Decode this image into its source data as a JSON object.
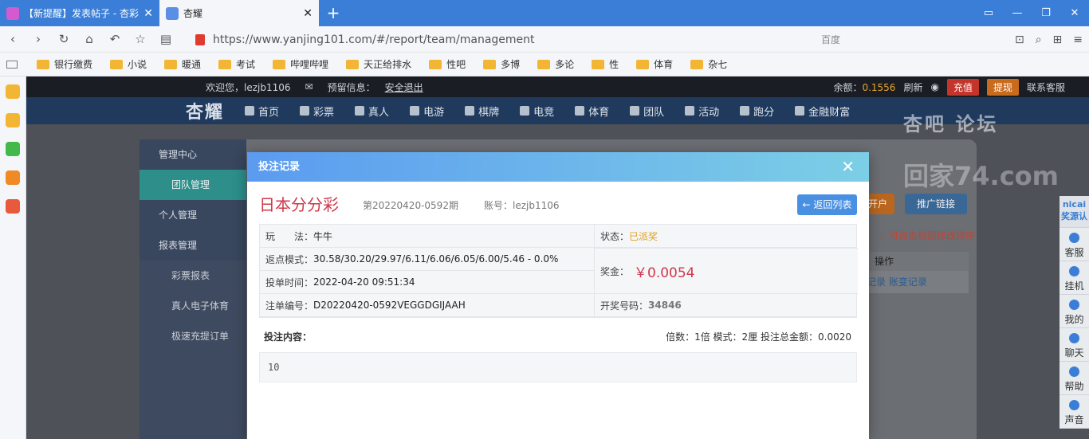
{
  "browser": {
    "tabs": [
      {
        "title": "【新提醒】发表帖子 - 杏彩"
      },
      {
        "title": "杏耀"
      }
    ],
    "url": "https://www.yanjing101.com/#/report/team/management",
    "search_placeholder": "百度"
  },
  "bookmarks": [
    "银行缴费",
    "小说",
    "暖通",
    "考试",
    "哔哩哔哩",
    "天正给排水",
    "性吧",
    "多博",
    "多论",
    "性",
    "体育",
    "杂七"
  ],
  "site": {
    "welcome": "欢迎您，lezjb1106",
    "reserve": "预留信息：",
    "logout": "安全退出",
    "balance_label": "余额：",
    "balance": "0.1556",
    "refresh": "刷新",
    "charge": "充值",
    "withdraw": "提现",
    "service": "联系客服",
    "logo": "杏耀",
    "nav": [
      "首页",
      "彩票",
      "真人",
      "电游",
      "棋牌",
      "电竞",
      "体育",
      "团队",
      "活动",
      "跑分",
      "金融财富"
    ]
  },
  "menu": {
    "groups": [
      {
        "label": "管理中心",
        "items": [
          "团队管理"
        ]
      },
      {
        "label": "个人管理",
        "items": []
      },
      {
        "label": "报表管理",
        "items": [
          "彩票报表",
          "真人电子体育",
          "极速充提订单"
        ]
      }
    ]
  },
  "bg": {
    "open_account": "开户",
    "promo_link": "推广链接",
    "hint": "：可点击标题修改排序",
    "op_header": "操作",
    "op_row": "记录  账变记录"
  },
  "rfloat": [
    "客服",
    "挂机",
    "我的",
    "聊天",
    "帮助",
    "声音"
  ],
  "rfloat_top": "nicai 奖源认",
  "watermark": {
    "line1": "杏吧 论坛",
    "line2": "回家74.com"
  },
  "modal": {
    "header": "投注记录",
    "game": "日本分分彩",
    "period": "第20220420-0592期",
    "account": "账号：lezjb1106",
    "back": "返回列表",
    "play_label": "玩　　法：",
    "play": "牛牛",
    "status_label": "状态：",
    "status": "已派奖",
    "rebate_label": "返点模式：",
    "rebate": "30.58/30.20/29.97/6.11/6.06/6.05/6.00/5.46 - 0.0%",
    "prize_label": "奖金：",
    "prize": "￥0.0054",
    "time_label": "投单时间：",
    "time": "2022-04-20 09:51:34",
    "order_label": "注单编号：",
    "order": "D20220420-0592VEGGDGIJAAH",
    "win_label": "开奖号码：",
    "win_number": "34846",
    "content_label": "投注内容：",
    "summary": "倍数：1倍   模式：2厘   投注总金额：0.0020",
    "content": "10"
  }
}
